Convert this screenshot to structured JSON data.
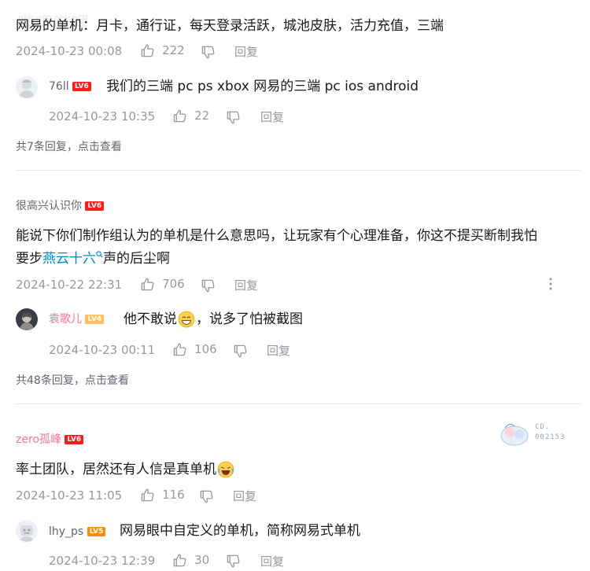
{
  "comments": [
    {
      "text": "网易的单机：月卡，通行证，每天登录活跃，城池皮肤，活力充值，三端",
      "time": "2024-10-23 00:08",
      "likes": "222",
      "reply_label": "回复",
      "sub_replies": [
        {
          "user": "76ll",
          "level": "LV6",
          "text": "我们的三端 pc ps xbox 网易的三端 pc ios android",
          "time": "2024-10-23 10:35",
          "likes": "22",
          "reply_label": "回复"
        }
      ],
      "more_replies": "共7条回复，点击查看"
    },
    {
      "user": "很高兴认识你",
      "level": "LV6",
      "text_line1": "能说下你们制作组认为的单机是什么意思吗，让玩家有个心理准备，你这不提买断制我怕",
      "text_line2_a": "要步",
      "text_line2_link": "燕云十六",
      "text_line2_b": "声的后尘啊",
      "time": "2024-10-22 22:31",
      "likes": "706",
      "reply_label": "回复",
      "sub_replies": [
        {
          "user": "袁歌儿",
          "level": "LV4",
          "text_a": "他不敢说",
          "text_b": "，说多了怕被截图",
          "time": "2024-10-23 00:11",
          "likes": "106",
          "reply_label": "回复"
        }
      ],
      "more_replies": "共48条回复，点击查看"
    },
    {
      "user": "zero孤峰",
      "level": "LV6",
      "badge_text_1": "CD.",
      "badge_text_2": "002153",
      "text": "率土团队，居然还有人信是真单机",
      "time": "2024-10-23 11:05",
      "likes": "116",
      "reply_label": "回复",
      "sub_replies": [
        {
          "user": "lhy_ps",
          "level": "LV5",
          "text": "网易眼中自定义的单机，简称网易式单机",
          "time": "2024-10-23 12:39",
          "likes": "30",
          "reply_label": "回复"
        }
      ]
    }
  ],
  "watermark": "哔哩哔哩",
  "colors": {
    "text": "#18191c",
    "meta": "#9499a0",
    "link": "#008ac5",
    "vip_name": "#fb7299",
    "lv6": "#ff1a1a",
    "lv5": "#ff8c00",
    "lv4": "#ffbf60"
  }
}
